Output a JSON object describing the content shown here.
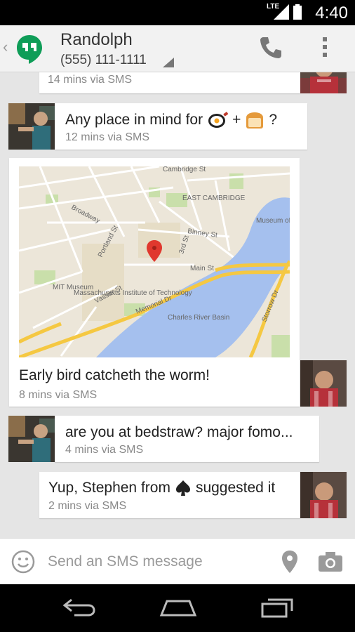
{
  "status_bar": {
    "time": "4:40",
    "network": "LTE"
  },
  "header": {
    "contact_name": "Randolph",
    "contact_phone": "(555) 111-1111"
  },
  "messages": [
    {
      "text": "",
      "meta": "14 mins via SMS",
      "sender": "me"
    },
    {
      "text_before": "Any place in mind for",
      "emoji_1": "frying-pan-egg",
      "plus": "+",
      "emoji_2": "bread",
      "text_after": "?",
      "meta": "12 mins via SMS",
      "sender": "them"
    },
    {
      "map_labels": [
        "Cambridge St",
        "EAST CAMBRIDGE",
        "Broadway",
        "Binney St",
        "Portland St",
        "3rd St",
        "Museum of Science",
        "MIT Museum",
        "Vassar St",
        "Main St",
        "Massachusetts Institute of Technology",
        "Memorial Dr",
        "Charles River Basin",
        "Storrow Dr"
      ],
      "text": "Early bird catcheth the worm!",
      "meta": "8 mins via SMS",
      "sender": "me"
    },
    {
      "text": "are you at bedstraw? major fomo...",
      "meta": "4 mins via SMS",
      "sender": "them"
    },
    {
      "text_before": "Yup, Stephen from",
      "emoji": "spade",
      "text_after": "suggested it",
      "meta": "2 mins via SMS",
      "sender": "me"
    }
  ],
  "composer": {
    "placeholder": "Send an SMS message"
  },
  "colors": {
    "hangouts_green": "#0f9d58",
    "map_water": "#a5c0ee",
    "map_land": "#ece6d9",
    "map_road": "#f5c842"
  }
}
